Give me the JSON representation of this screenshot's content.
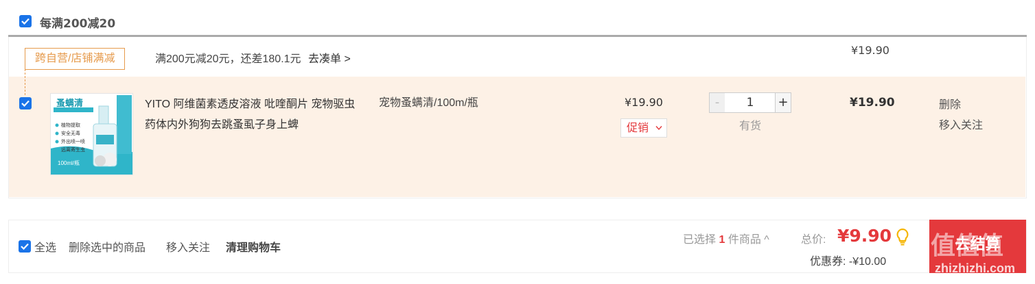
{
  "shop": {
    "header_title": "每满200减20",
    "promo_tag": "跨自营/店铺满减",
    "promo_text": "满200元减20元，还差180.1元",
    "promo_link": "去凑单 >",
    "price_top": "¥19.90"
  },
  "item": {
    "name": "YITO 阿维菌素透皮溶液 吡喹酮片 宠物驱虫药体内外狗狗去跳蚤虱子身上蜱",
    "spec": "宠物蚤螨清/100m/瓶",
    "unit_price": "¥19.90",
    "promo_select": "促销",
    "quantity": "1",
    "minus_label": "-",
    "plus_label": "+",
    "stock": "有货",
    "subtotal": "¥19.90",
    "op_delete": "删除",
    "op_follow": "移入关注",
    "thumb": {
      "brand": "蚤螨清",
      "features": [
        "植物提取",
        "安全无毒",
        "外出喷一喷",
        "远离寄生虫"
      ],
      "volume": "100ml/瓶"
    }
  },
  "footer": {
    "select_all": "全选",
    "delete_selected": "删除选中的商品",
    "move_follow": "移入关注",
    "clear_cart": "清理购物车",
    "selected_prefix": "已选择",
    "selected_count": "1",
    "selected_suffix": "件商品 ^",
    "total_label": "总价:",
    "total_amount": "¥9.90",
    "coupon": "优惠券: -¥10.00",
    "checkout": "去结算"
  },
  "watermark": {
    "main": "值值值",
    "sub": "zhizhizhi.com"
  },
  "colors": {
    "accent_red": "#e4393c",
    "checkbox_blue": "#1a73e8",
    "row_bg": "#fdf1e6",
    "promo_orange": "#e69a4b"
  }
}
